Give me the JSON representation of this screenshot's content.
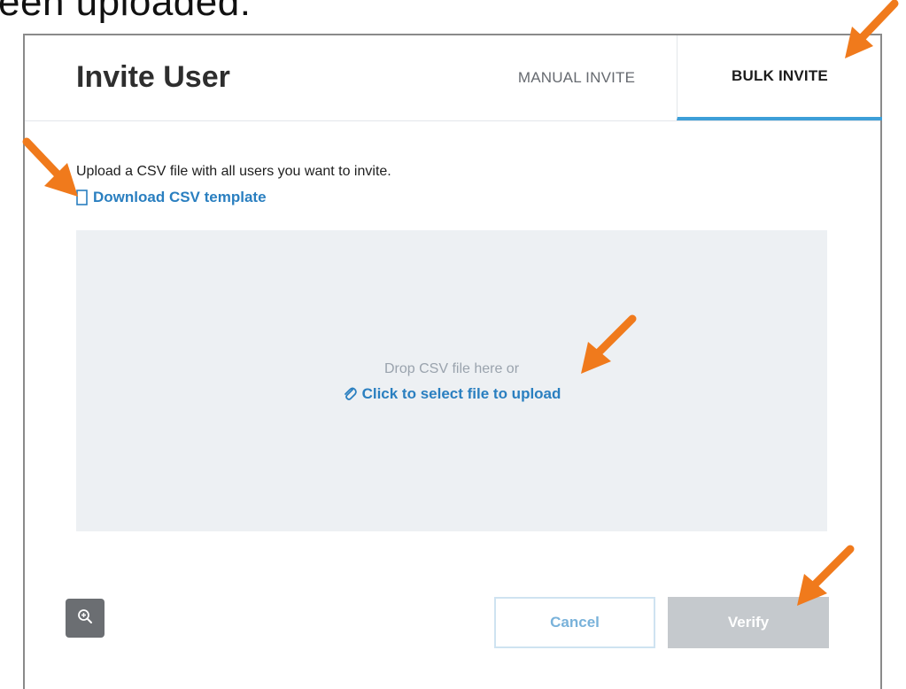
{
  "slide": {
    "caption": "een uploaded:"
  },
  "dialog": {
    "title": "Invite User",
    "tabs": [
      {
        "label": "MANUAL INVITE",
        "active": false
      },
      {
        "label": "BULK INVITE",
        "active": true
      }
    ],
    "instructions": "Upload a CSV file with all users you want to invite.",
    "download_link": {
      "label": "Download CSV template",
      "icon": "document-icon"
    },
    "dropzone": {
      "hint": "Drop CSV file here or",
      "select_label": "Click to select file to upload",
      "icon": "paperclip-icon"
    },
    "zoom_button": {
      "icon": "zoom-in-icon"
    },
    "buttons": {
      "cancel": "Cancel",
      "verify": "Verify"
    }
  },
  "annotations": {
    "arrow_color": "#f07a1c",
    "arrow_count": 4
  },
  "colors": {
    "accent": "#2a7fc0",
    "tab_underline": "#3d9fd8",
    "verify_disabled": "#c5c9cd",
    "dropzone_bg": "#edf0f3"
  }
}
